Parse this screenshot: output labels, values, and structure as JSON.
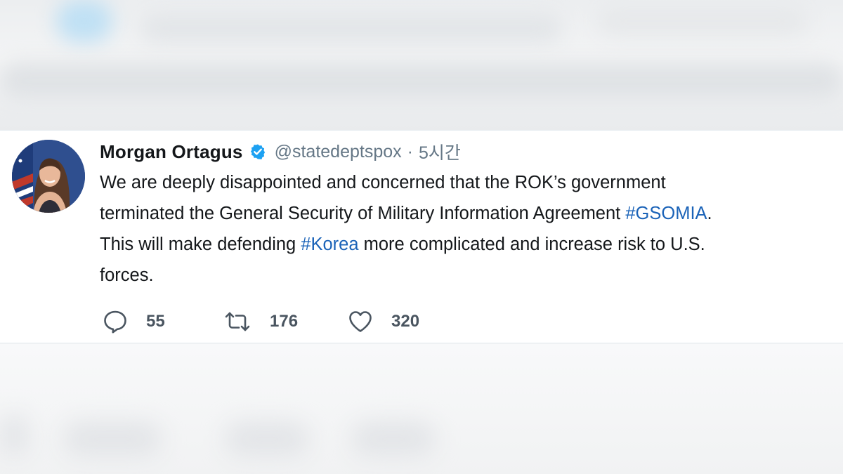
{
  "tweet": {
    "author_name": "Morgan Ortagus",
    "handle": "@statedeptspox",
    "separator": "·",
    "time": "5시간",
    "lines": {
      "l1": "We are deeply disappointed and concerned that the ROK’s government",
      "l2_text": "terminated the General Security of Military Information Agreement ",
      "l2_hashtag": "#GSOMIA",
      "l2_end": ".",
      "l3_start": "This will make defending ",
      "l3_hashtag": "#Korea",
      "l3_end": " more complicated and increase risk to U.S.",
      "l4": "forces."
    },
    "actions": {
      "reply": {
        "icon": "reply-icon",
        "count": "55"
      },
      "retweet": {
        "icon": "retweet-icon",
        "count": "176"
      },
      "like": {
        "icon": "heart-icon",
        "count": "320"
      }
    }
  },
  "colors": {
    "hashtag": "#1b63b8",
    "verified": "#1da1f2",
    "secondary_text": "#657786"
  }
}
